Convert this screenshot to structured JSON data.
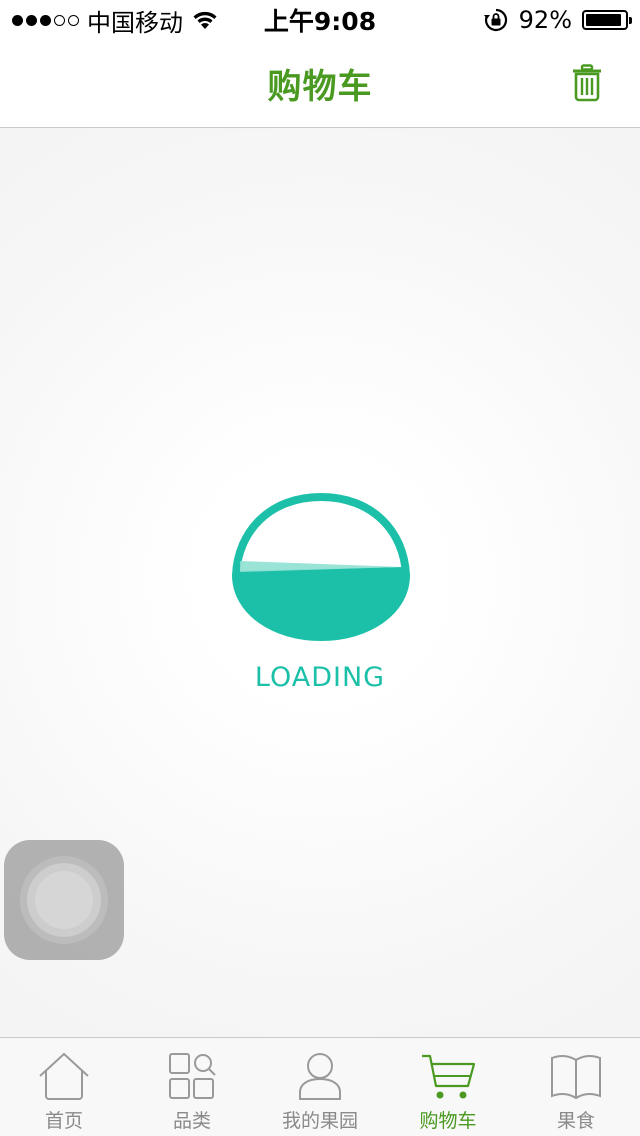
{
  "status_bar": {
    "carrier": "中国移动",
    "time": "上午9:08",
    "battery_percent": "92%",
    "battery_level": 0.92,
    "signal_filled": 3,
    "signal_total": 5
  },
  "nav": {
    "title": "购物车",
    "right_icon": "trash-icon"
  },
  "content": {
    "loading_text": "LOADING",
    "loader_icon": "basket-loader-icon"
  },
  "tabs": [
    {
      "label": "首页",
      "icon": "home-icon",
      "active": false
    },
    {
      "label": "品类",
      "icon": "category-icon",
      "active": false
    },
    {
      "label": "我的果园",
      "icon": "user-icon",
      "active": false
    },
    {
      "label": "购物车",
      "icon": "cart-icon",
      "active": true
    },
    {
      "label": "果食",
      "icon": "book-icon",
      "active": false
    }
  ],
  "colors": {
    "brand_green": "#4a9a22",
    "loader_teal": "#1cc0a8",
    "inactive_gray": "#8a8a8a"
  }
}
